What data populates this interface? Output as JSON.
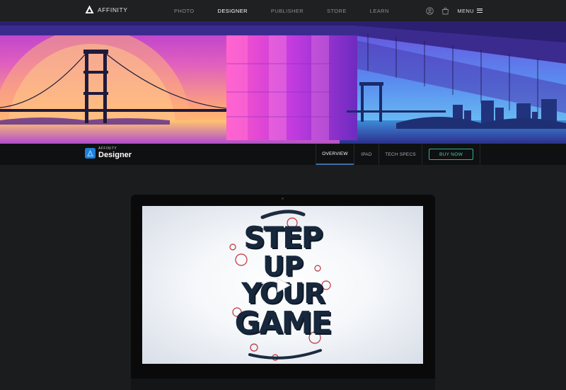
{
  "brand": {
    "name": "AFFINITY"
  },
  "nav": {
    "links": [
      {
        "label": "PHOTO",
        "active": false
      },
      {
        "label": "DESIGNER",
        "active": true
      },
      {
        "label": "PUBLISHER",
        "active": false
      },
      {
        "label": "STORE",
        "active": false
      },
      {
        "label": "LEARN",
        "active": false
      }
    ],
    "menu_label": "MENU"
  },
  "product": {
    "brand": "AFFINITY",
    "name": "Designer",
    "tabs": [
      {
        "label": "OVERVIEW",
        "active": true
      },
      {
        "label": "IPAD",
        "active": false
      },
      {
        "label": "TECH SPECS",
        "active": false
      }
    ],
    "buy_label": "BUY NOW"
  },
  "video": {
    "lettering": [
      "STEP",
      "UP",
      "YOUR",
      "GAME"
    ]
  },
  "colors": {
    "accent_green": "#40d9a6",
    "tab_underline": "#3f6ea8",
    "page_bg": "#1b1c1d"
  }
}
